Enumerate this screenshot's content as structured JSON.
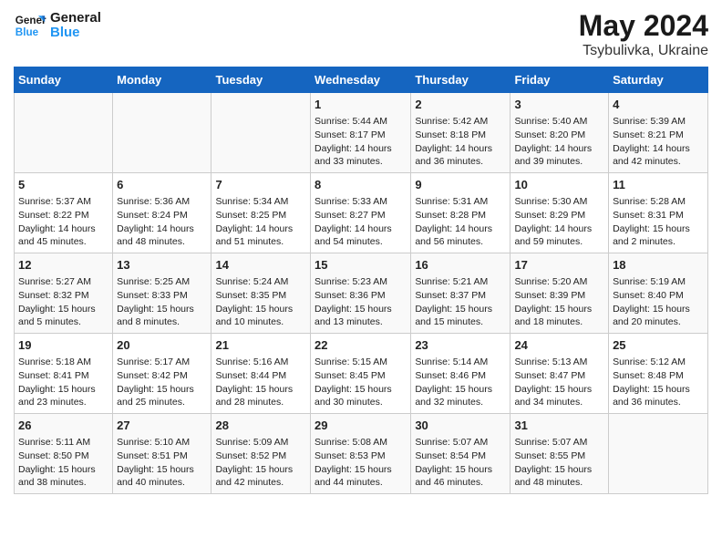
{
  "header": {
    "title": "May 2024",
    "subtitle": "Tsybulivka, Ukraine",
    "logo_general": "General",
    "logo_blue": "Blue"
  },
  "weekdays": [
    "Sunday",
    "Monday",
    "Tuesday",
    "Wednesday",
    "Thursday",
    "Friday",
    "Saturday"
  ],
  "weeks": [
    [
      {
        "day": "",
        "info": ""
      },
      {
        "day": "",
        "info": ""
      },
      {
        "day": "",
        "info": ""
      },
      {
        "day": "1",
        "info": "Sunrise: 5:44 AM\nSunset: 8:17 PM\nDaylight: 14 hours and 33 minutes."
      },
      {
        "day": "2",
        "info": "Sunrise: 5:42 AM\nSunset: 8:18 PM\nDaylight: 14 hours and 36 minutes."
      },
      {
        "day": "3",
        "info": "Sunrise: 5:40 AM\nSunset: 8:20 PM\nDaylight: 14 hours and 39 minutes."
      },
      {
        "day": "4",
        "info": "Sunrise: 5:39 AM\nSunset: 8:21 PM\nDaylight: 14 hours and 42 minutes."
      }
    ],
    [
      {
        "day": "5",
        "info": "Sunrise: 5:37 AM\nSunset: 8:22 PM\nDaylight: 14 hours and 45 minutes."
      },
      {
        "day": "6",
        "info": "Sunrise: 5:36 AM\nSunset: 8:24 PM\nDaylight: 14 hours and 48 minutes."
      },
      {
        "day": "7",
        "info": "Sunrise: 5:34 AM\nSunset: 8:25 PM\nDaylight: 14 hours and 51 minutes."
      },
      {
        "day": "8",
        "info": "Sunrise: 5:33 AM\nSunset: 8:27 PM\nDaylight: 14 hours and 54 minutes."
      },
      {
        "day": "9",
        "info": "Sunrise: 5:31 AM\nSunset: 8:28 PM\nDaylight: 14 hours and 56 minutes."
      },
      {
        "day": "10",
        "info": "Sunrise: 5:30 AM\nSunset: 8:29 PM\nDaylight: 14 hours and 59 minutes."
      },
      {
        "day": "11",
        "info": "Sunrise: 5:28 AM\nSunset: 8:31 PM\nDaylight: 15 hours and 2 minutes."
      }
    ],
    [
      {
        "day": "12",
        "info": "Sunrise: 5:27 AM\nSunset: 8:32 PM\nDaylight: 15 hours and 5 minutes."
      },
      {
        "day": "13",
        "info": "Sunrise: 5:25 AM\nSunset: 8:33 PM\nDaylight: 15 hours and 8 minutes."
      },
      {
        "day": "14",
        "info": "Sunrise: 5:24 AM\nSunset: 8:35 PM\nDaylight: 15 hours and 10 minutes."
      },
      {
        "day": "15",
        "info": "Sunrise: 5:23 AM\nSunset: 8:36 PM\nDaylight: 15 hours and 13 minutes."
      },
      {
        "day": "16",
        "info": "Sunrise: 5:21 AM\nSunset: 8:37 PM\nDaylight: 15 hours and 15 minutes."
      },
      {
        "day": "17",
        "info": "Sunrise: 5:20 AM\nSunset: 8:39 PM\nDaylight: 15 hours and 18 minutes."
      },
      {
        "day": "18",
        "info": "Sunrise: 5:19 AM\nSunset: 8:40 PM\nDaylight: 15 hours and 20 minutes."
      }
    ],
    [
      {
        "day": "19",
        "info": "Sunrise: 5:18 AM\nSunset: 8:41 PM\nDaylight: 15 hours and 23 minutes."
      },
      {
        "day": "20",
        "info": "Sunrise: 5:17 AM\nSunset: 8:42 PM\nDaylight: 15 hours and 25 minutes."
      },
      {
        "day": "21",
        "info": "Sunrise: 5:16 AM\nSunset: 8:44 PM\nDaylight: 15 hours and 28 minutes."
      },
      {
        "day": "22",
        "info": "Sunrise: 5:15 AM\nSunset: 8:45 PM\nDaylight: 15 hours and 30 minutes."
      },
      {
        "day": "23",
        "info": "Sunrise: 5:14 AM\nSunset: 8:46 PM\nDaylight: 15 hours and 32 minutes."
      },
      {
        "day": "24",
        "info": "Sunrise: 5:13 AM\nSunset: 8:47 PM\nDaylight: 15 hours and 34 minutes."
      },
      {
        "day": "25",
        "info": "Sunrise: 5:12 AM\nSunset: 8:48 PM\nDaylight: 15 hours and 36 minutes."
      }
    ],
    [
      {
        "day": "26",
        "info": "Sunrise: 5:11 AM\nSunset: 8:50 PM\nDaylight: 15 hours and 38 minutes."
      },
      {
        "day": "27",
        "info": "Sunrise: 5:10 AM\nSunset: 8:51 PM\nDaylight: 15 hours and 40 minutes."
      },
      {
        "day": "28",
        "info": "Sunrise: 5:09 AM\nSunset: 8:52 PM\nDaylight: 15 hours and 42 minutes."
      },
      {
        "day": "29",
        "info": "Sunrise: 5:08 AM\nSunset: 8:53 PM\nDaylight: 15 hours and 44 minutes."
      },
      {
        "day": "30",
        "info": "Sunrise: 5:07 AM\nSunset: 8:54 PM\nDaylight: 15 hours and 46 minutes."
      },
      {
        "day": "31",
        "info": "Sunrise: 5:07 AM\nSunset: 8:55 PM\nDaylight: 15 hours and 48 minutes."
      },
      {
        "day": "",
        "info": ""
      }
    ]
  ]
}
